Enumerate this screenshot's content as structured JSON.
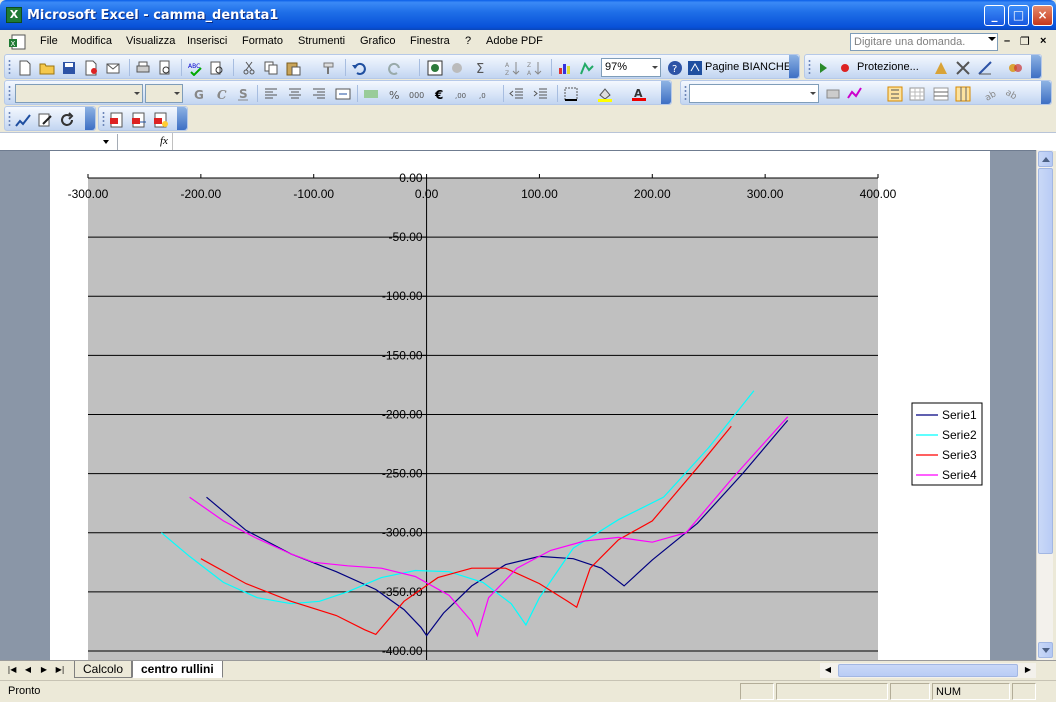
{
  "window": {
    "title": "Microsoft Excel - camma_dentata1"
  },
  "menu": {
    "items": [
      "File",
      "Modifica",
      "Visualizza",
      "Inserisci",
      "Formato",
      "Strumenti",
      "Grafico",
      "Finestra",
      "?",
      "Adobe PDF"
    ]
  },
  "help": {
    "placeholder": "Digitare una domanda."
  },
  "toolbar": {
    "zoom": "97%",
    "pagine_label": "Pagine BIANCHE",
    "protezione_label": "Protezione..."
  },
  "formula_bar": {
    "name_box": "",
    "fx_label": "fx",
    "content": ""
  },
  "sheet_tabs": [
    {
      "label": "Calcolo",
      "active": false
    },
    {
      "label": "centro rullini",
      "active": true
    }
  ],
  "status": {
    "text": "Pronto",
    "num": "NUM"
  },
  "colors": {
    "plot_area": "#c0c0c0",
    "serie1": "#000080",
    "serie2": "#00ffff",
    "serie3": "#ff0000",
    "serie4": "#ff00ff"
  },
  "chart_data": {
    "type": "scatter",
    "title": "",
    "xlabel": "",
    "ylabel": "",
    "xlim": [
      -300,
      400
    ],
    "ylim": [
      -400,
      0
    ],
    "x_ticks": [
      "-300.00",
      "-200.00",
      "-100.00",
      "0.00",
      "100.00",
      "200.00",
      "300.00",
      "400.00"
    ],
    "y_ticks": [
      "0.00",
      "-50.00",
      "-100.00",
      "-150.00",
      "-200.00",
      "-250.00",
      "-300.00",
      "-350.00",
      "-400.00"
    ],
    "grid": "horizontal",
    "legend": "right",
    "series": [
      {
        "name": "Serie1",
        "x": [
          -195,
          -160,
          -120,
          -80,
          -45,
          -20,
          -5,
          0,
          15,
          40,
          70,
          100,
          130,
          155,
          175,
          200,
          240,
          280,
          320
        ],
        "y": [
          -270,
          -298,
          -318,
          -333,
          -348,
          -365,
          -380,
          -387,
          -368,
          -345,
          -327,
          -320,
          -322,
          -330,
          -345,
          -323,
          -292,
          -250,
          -205
        ]
      },
      {
        "name": "Serie2",
        "x": [
          -235,
          -210,
          -180,
          -150,
          -120,
          -95,
          -70,
          -40,
          -10,
          20,
          50,
          75,
          88,
          100,
          130,
          170,
          210,
          250,
          290
        ],
        "y": [
          -300,
          -320,
          -342,
          -355,
          -360,
          -358,
          -350,
          -338,
          -332,
          -333,
          -342,
          -360,
          -378,
          -355,
          -313,
          -289,
          -270,
          -228,
          -180
        ]
      },
      {
        "name": "Serie3",
        "x": [
          -200,
          -160,
          -120,
          -80,
          -55,
          -45,
          -20,
          10,
          40,
          70,
          100,
          125,
          133,
          145,
          170,
          200,
          240,
          270
        ],
        "y": [
          -322,
          -343,
          -358,
          -370,
          -382,
          -386,
          -358,
          -338,
          -330,
          -330,
          -343,
          -358,
          -363,
          -330,
          -306,
          -290,
          -245,
          -210
        ]
      },
      {
        "name": "Serie4",
        "x": [
          -210,
          -180,
          -150,
          -120,
          -100,
          -70,
          -40,
          -10,
          20,
          40,
          45,
          55,
          80,
          110,
          140,
          170,
          200,
          230,
          270,
          320
        ],
        "y": [
          -270,
          -290,
          -305,
          -318,
          -325,
          -328,
          -330,
          -337,
          -353,
          -375,
          -387,
          -355,
          -330,
          -315,
          -307,
          -304,
          -308,
          -300,
          -255,
          -202
        ]
      }
    ]
  }
}
